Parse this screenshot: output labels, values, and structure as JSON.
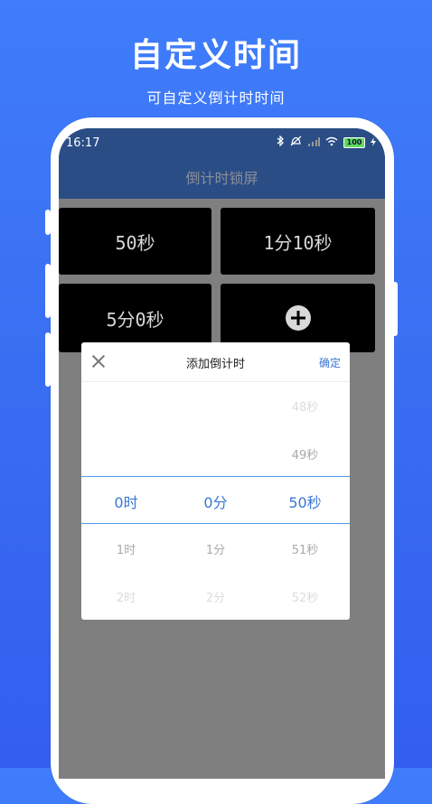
{
  "promo": {
    "title": "自定义时间",
    "subtitle": "可自定义倒计时时间"
  },
  "status_bar": {
    "time": "16:17",
    "battery": "100"
  },
  "app": {
    "title": "倒计时锁屏"
  },
  "tiles": [
    {
      "label": "50秒"
    },
    {
      "label": "1分10秒"
    },
    {
      "label": "5分0秒"
    },
    {
      "label": "",
      "icon": "plus-circle-icon"
    }
  ],
  "dialog": {
    "title": "添加倒计时",
    "confirm_label": "确定",
    "close_icon": "close-icon",
    "hours": {
      "selected": "0时",
      "below": [
        "1时",
        "2时"
      ]
    },
    "minutes": {
      "selected": "0分",
      "below": [
        "1分",
        "2分"
      ]
    },
    "seconds": {
      "above": [
        "48秒",
        "49秒"
      ],
      "selected": "50秒",
      "below": [
        "51秒",
        "52秒"
      ]
    }
  },
  "colors": {
    "background": "#3a6ff2",
    "topbar": "#2a4d86",
    "accent": "#3a76d2",
    "tile": "#000000",
    "screen": "#7f7f7f"
  }
}
